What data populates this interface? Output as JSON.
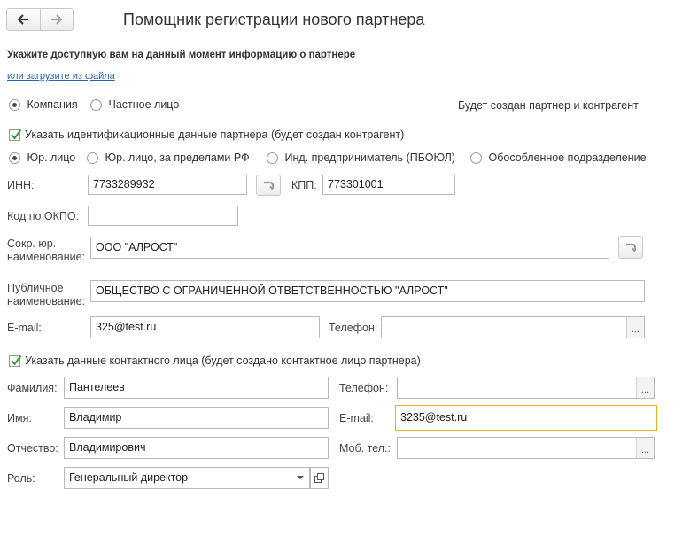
{
  "window": {
    "title": "Помощник регистрации нового партнера"
  },
  "header": {
    "subtitle": "Укажите доступную вам на данный момент информацию о партнере",
    "load_link": "или загрузите из файла"
  },
  "partner_type": {
    "options": [
      "Компания",
      "Частное лицо"
    ],
    "selected": "Компания",
    "info": "Будет создан партнер и контрагент"
  },
  "ident": {
    "checkbox_label": "Указать идентификационные данные партнера (будет создан контрагент)",
    "checked": true,
    "legal_options": [
      "Юр. лицо",
      "Юр. лицо, за пределами РФ",
      "Инд. предприниматель (ПБОЮЛ)",
      "Обособленное подразделение"
    ],
    "selected": "Юр. лицо",
    "inn_label": "ИНН:",
    "inn": "7733289932",
    "kpp_label": "КПП:",
    "kpp": "773301001",
    "okpo_label": "Код по ОКПО:",
    "okpo": "",
    "short_name_label_1": "Сокр. юр.",
    "short_name_label_2": "наименование:",
    "short_name": "ООО \"АЛРОСТ\"",
    "public_name_label_1": "Публичное",
    "public_name_label_2": "наименование:",
    "public_name": "ОБЩЕСТВО С ОГРАНИЧЕННОЙ ОТВЕТСТВЕННОСТЬЮ \"АЛРОСТ\"",
    "email_label": "E-mail:",
    "email": "325@test.ru",
    "phone_label": "Телефон:",
    "phone": ""
  },
  "contact": {
    "checkbox_label": "Указать данные контактного лица (будет создано контактное лицо партнера)",
    "checked": true,
    "lastname_label": "Фамилия:",
    "lastname": "Пантелеев",
    "firstname_label": "Имя:",
    "firstname": "Владимир",
    "middlename_label": "Отчество:",
    "middlename": "Владимирович",
    "role_label": "Роль:",
    "role": "Генеральный директор",
    "phone_label": "Телефон:",
    "phone": "",
    "email_label": "E-mail:",
    "email": "3235@test.ru",
    "mobile_label": "Моб. тел.:",
    "mobile": ""
  },
  "colors": {
    "accent_focus": "#e5b21b",
    "link": "#2c62b0",
    "check": "#3a9a3a"
  },
  "icons": [
    "back-arrow-icon",
    "forward-arrow-icon",
    "checkmark-icon",
    "fill-arrow-icon",
    "dots-icon",
    "dropdown-arrow-icon",
    "open-form-icon"
  ]
}
